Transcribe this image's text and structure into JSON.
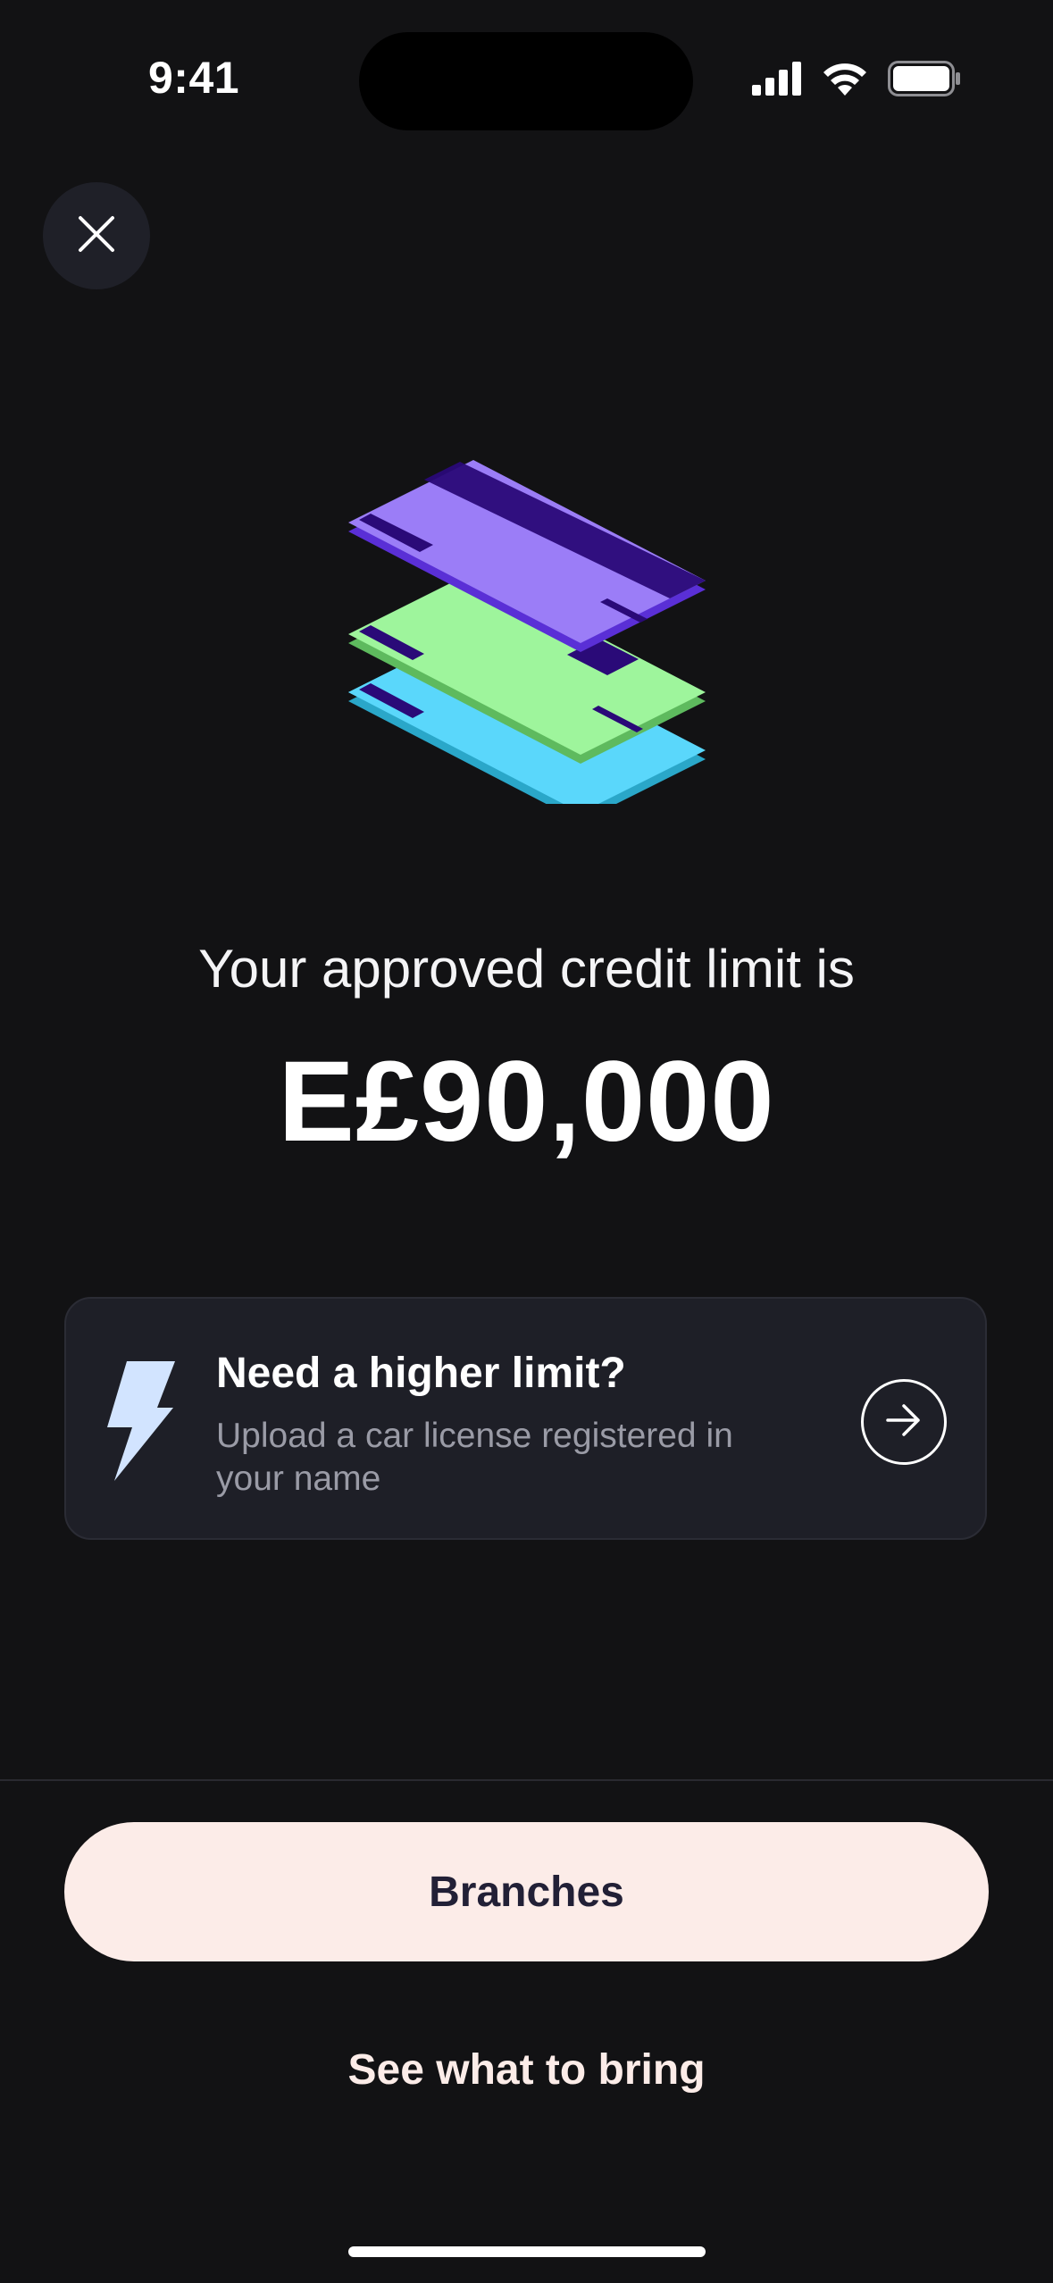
{
  "status_bar": {
    "time": "9:41",
    "icons": [
      "cellular-signal-icon",
      "wifi-icon",
      "battery-icon"
    ]
  },
  "nav": {
    "close_icon": "close-icon"
  },
  "illustration": {
    "name": "stacked-credit-cards",
    "colors": {
      "top": "#9b7df7",
      "middle": "#9ef59c",
      "bottom": "#5ad7fb",
      "stripe": "#2a0a78"
    }
  },
  "limit": {
    "headline": "Your approved credit limit is",
    "amount": "E£90,000"
  },
  "promo": {
    "icon": "lightning-bolt-icon",
    "title": "Need a higher limit?",
    "subtitle": "Upload a car license registered in your name",
    "action_icon": "arrow-right-icon"
  },
  "actions": {
    "primary_label": "Branches",
    "secondary_label": "See what to bring"
  },
  "colors": {
    "background": "#121214",
    "card_background": "#1e1f27",
    "button_background": "#fcece8",
    "button_text": "#222036"
  }
}
